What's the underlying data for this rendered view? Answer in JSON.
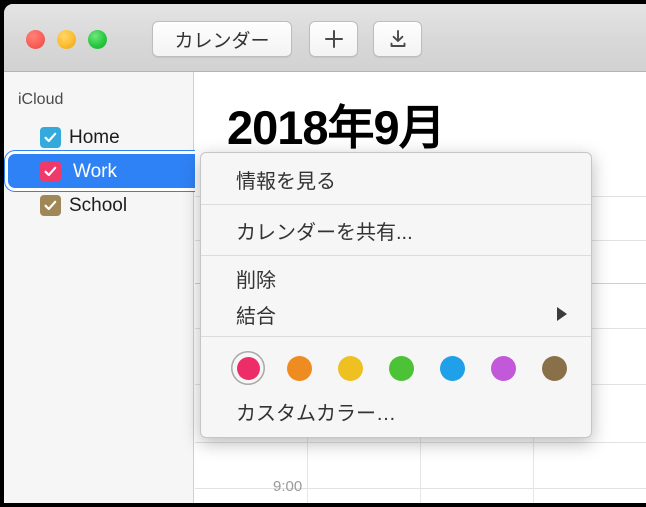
{
  "window": {
    "traffic_lights": [
      {
        "name": "close",
        "color": "#fa5f57"
      },
      {
        "name": "minimize",
        "color": "#febc2e"
      },
      {
        "name": "zoom",
        "color": "#28c840"
      }
    ]
  },
  "toolbar": {
    "calendar_button_label": "カレンダー",
    "add_button_label": "+",
    "import_button_icon": "download-icon"
  },
  "sidebar": {
    "source_header": "iCloud",
    "calendars": [
      {
        "name": "Home",
        "checked": true,
        "color": "#34AADC",
        "selected": false
      },
      {
        "name": "Work",
        "checked": true,
        "color": "#F0396B",
        "selected": true
      },
      {
        "name": "School",
        "checked": true,
        "color": "#A08757",
        "selected": false
      }
    ],
    "selection_color": "#2f82f5"
  },
  "main": {
    "month_title": "2018年9月",
    "time_labels": [
      "9:00"
    ]
  },
  "context_menu": {
    "items": [
      {
        "label": "情報を見る",
        "has_submenu": false
      },
      {
        "label": "カレンダーを共有...",
        "has_submenu": false
      },
      {
        "label": "削除",
        "has_submenu": false
      },
      {
        "label": "結合",
        "has_submenu": true
      }
    ],
    "colors": [
      {
        "name": "red",
        "hex": "#ED2D67",
        "selected": true
      },
      {
        "name": "orange",
        "hex": "#EE8C21",
        "selected": false
      },
      {
        "name": "yellow",
        "hex": "#EEC021",
        "selected": false
      },
      {
        "name": "green",
        "hex": "#4CC236",
        "selected": false
      },
      {
        "name": "blue",
        "hex": "#1FA0E8",
        "selected": false
      },
      {
        "name": "purple",
        "hex": "#C159D8",
        "selected": false
      },
      {
        "name": "brown",
        "hex": "#8A7049",
        "selected": false
      }
    ],
    "custom_color_label": "カスタムカラー…"
  }
}
